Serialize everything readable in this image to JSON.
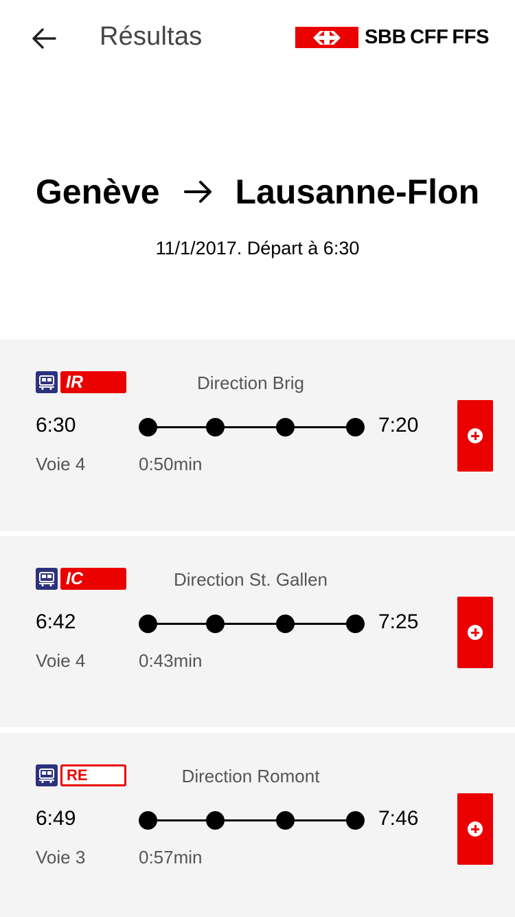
{
  "header": {
    "title": "Résultas",
    "back_icon": "arrow-left-icon",
    "logo_text": "SBB CFF FFS",
    "brand_color": "#eb0000"
  },
  "route": {
    "from": "Genève",
    "to": "Lausanne-Flon",
    "date_line": "11/1/2017. Départ à 6:30"
  },
  "connections": [
    {
      "category": "IR",
      "badge_style": "solid",
      "direction": "Direction Brig",
      "departure": "6:30",
      "arrival": "7:20",
      "platform": "Voie 4",
      "duration": "0:50min"
    },
    {
      "category": "IC",
      "badge_style": "solid",
      "direction": "Direction St. Gallen",
      "departure": "6:42",
      "arrival": "7:25",
      "platform": "Voie 4",
      "duration": "0:43min"
    },
    {
      "category": "RE",
      "badge_style": "outline",
      "direction": "Direction Romont",
      "departure": "6:49",
      "arrival": "7:46",
      "platform": "Voie 3",
      "duration": "0:57min"
    }
  ]
}
